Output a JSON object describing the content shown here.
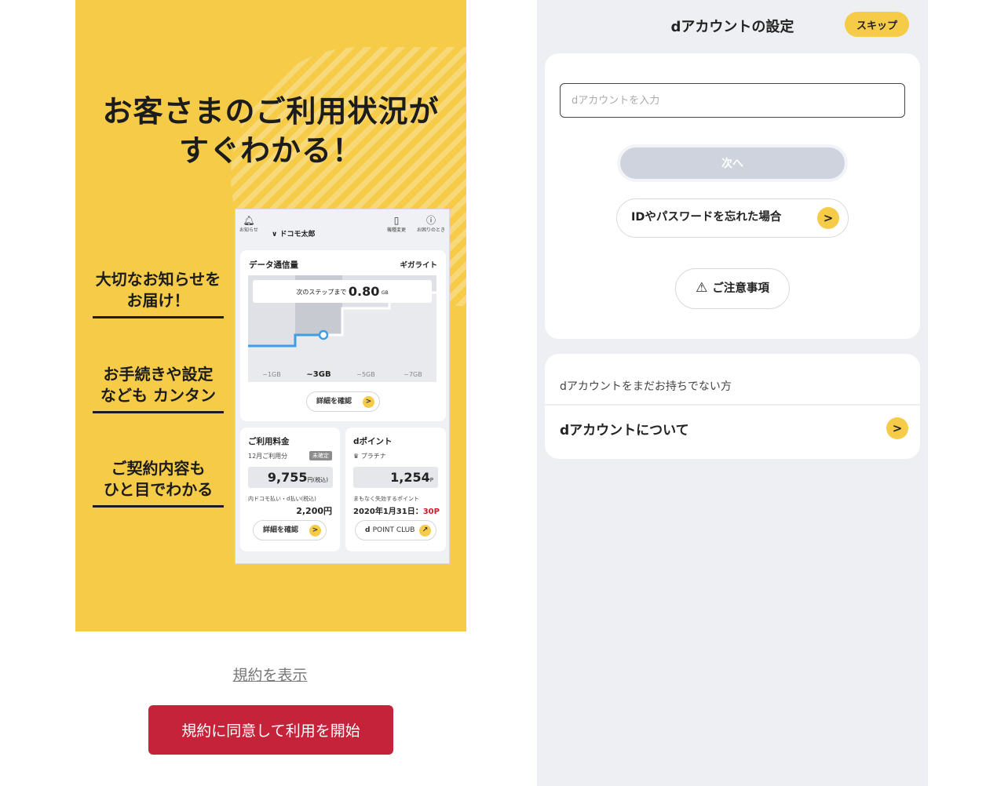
{
  "left": {
    "promo_title_line1": "お客さまのご利用状況が",
    "promo_title_line2": "すぐわかる！",
    "features": [
      {
        "line1": "大切なお知らせを",
        "line2": "お届け！"
      },
      {
        "line1": "お手続きや設定",
        "line2": "なども カンタン"
      },
      {
        "line1": "ご契約内容も",
        "line2": "ひと目でわかる"
      }
    ],
    "mock": {
      "bell_label": "お知らせ",
      "user_name": "ドコモ太郎",
      "device_label": "機種変更",
      "help_label": "お困りのとき",
      "data_title": "データ通信量",
      "plan": "ギガライト",
      "next_step_label": "次のステップまで",
      "next_step_value": "0.80",
      "next_step_unit": "GB",
      "tiers": [
        "~1GB",
        "~3GB",
        "~5GB",
        "~7GB"
      ],
      "detail_button": "詳細を確認",
      "fee_title": "ご利用料金",
      "fee_month": "12月ご利用分",
      "fee_badge": "未確定",
      "fee_value": "9,755",
      "fee_unit": "円(税込)",
      "fee_note": "内ドコモ払い・d払い(税込)",
      "fee_note_value": "2,200円",
      "fee_detail_button": "詳細を確認",
      "point_title": "dポイント",
      "point_rank": "プラチナ",
      "point_value": "1,254",
      "point_unit": "P",
      "point_note": "まもなく失効するポイント",
      "point_expiry": "2020年1月31日：",
      "point_expiry_value": "30P",
      "point_club_button": "POINT CLUB"
    },
    "terms_link": "規約を表示",
    "agree_button": "規約に同意して利用を開始"
  },
  "right": {
    "title": "dアカウントの設定",
    "skip": "スキップ",
    "input_placeholder": "dアカウントを入力",
    "next_button": "次へ",
    "forgot_button": "IDやパスワードを忘れた場合",
    "notice_button": "ご注意事項",
    "about_label": "dアカウントをまだお持ちでない方",
    "about_link": "dアカウントについて"
  },
  "colors": {
    "brand_yellow": "#f5cb47",
    "brand_red": "#c4233a",
    "background_gray": "#eeeff3"
  }
}
